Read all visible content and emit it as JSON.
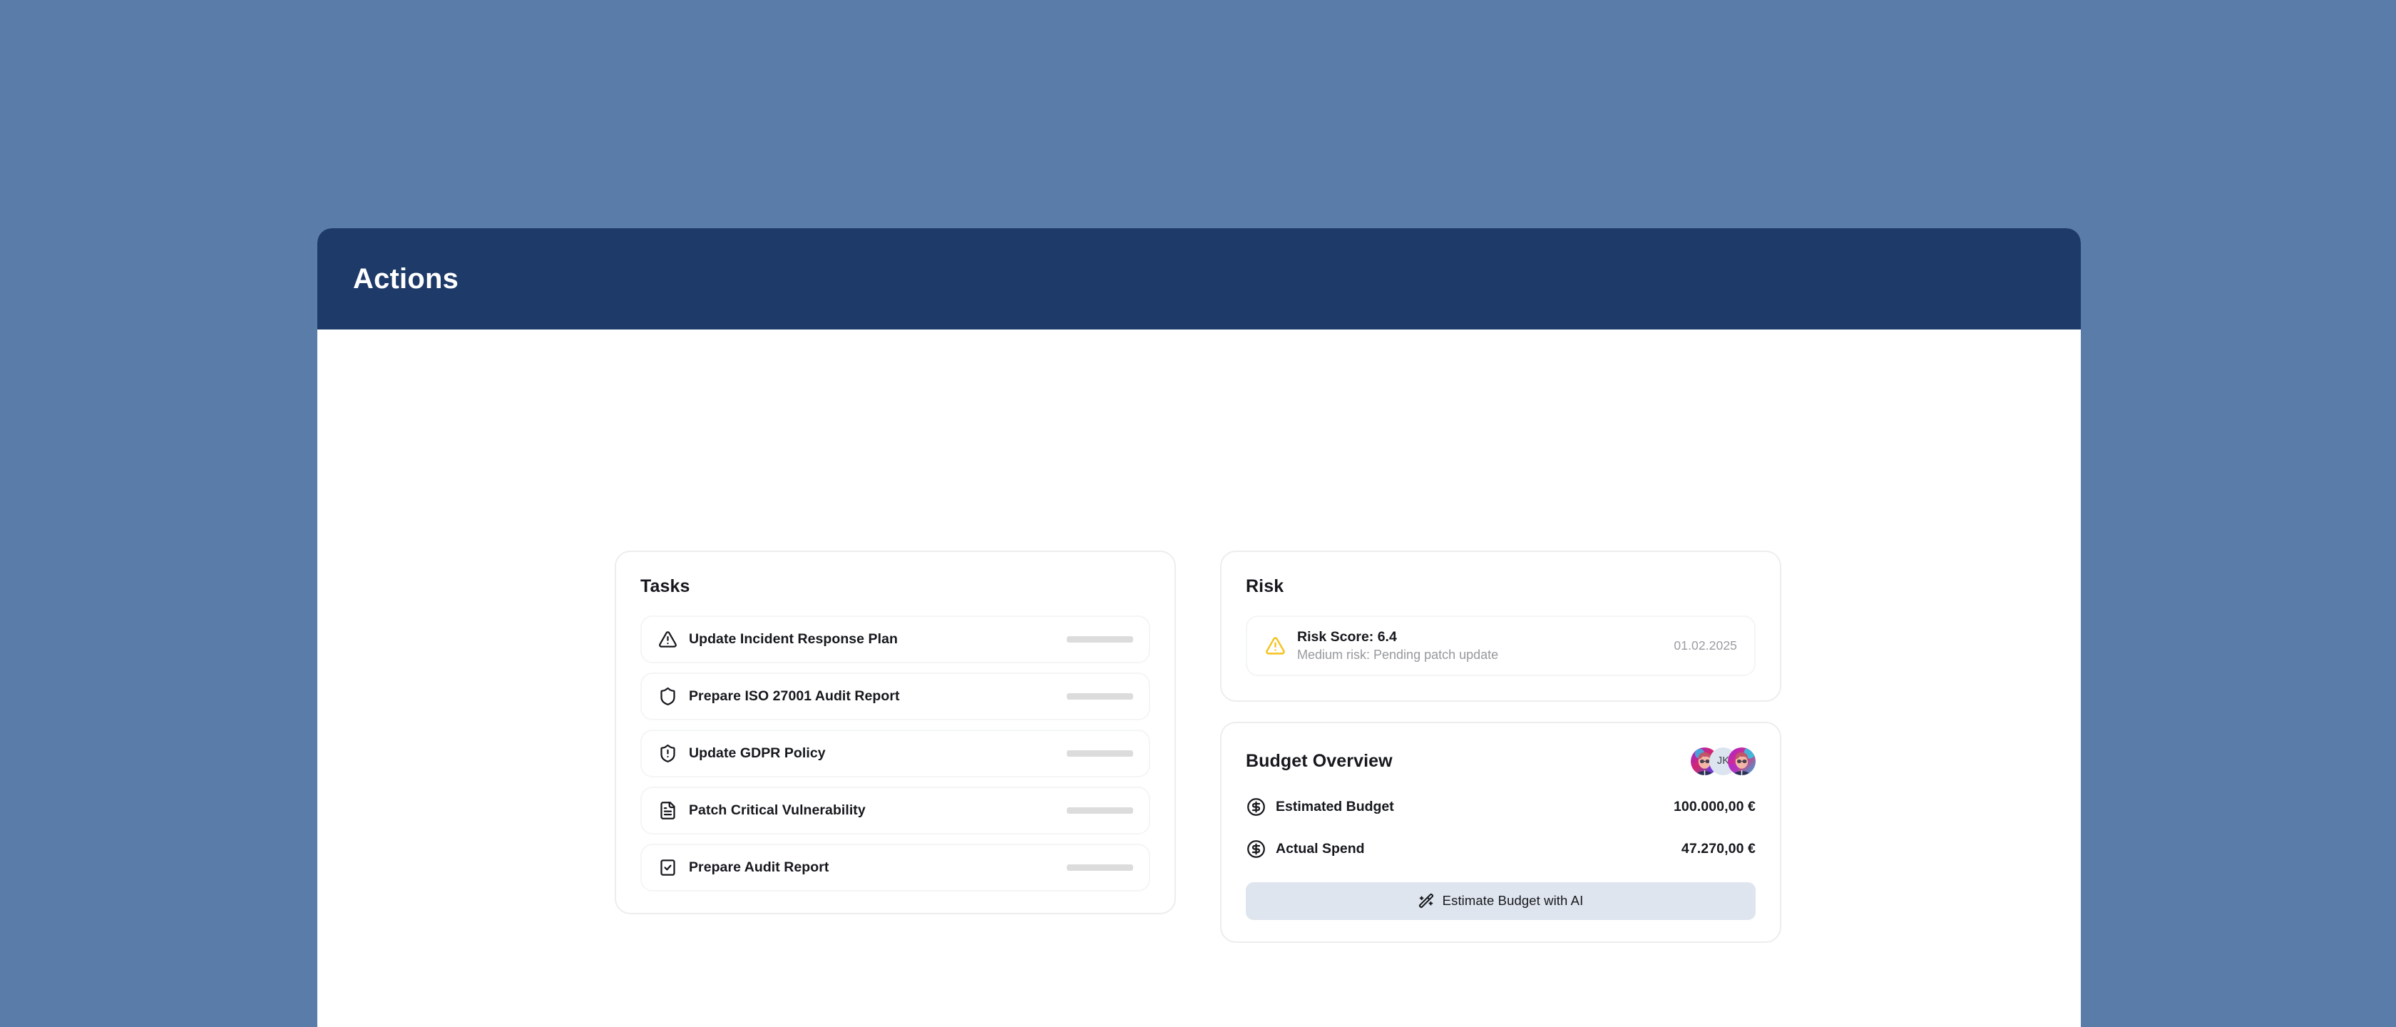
{
  "theme": {
    "page_background": "#5a7ca8",
    "header_background": "#1e3a68",
    "panel_background": "#ffffff",
    "card_border": "#eceded",
    "row_border": "#f4f5f6",
    "skeleton": "#dcdcdd",
    "warning_amber": "#f5c21b",
    "ai_button_background": "#dfe5ee",
    "text_primary": "#16181d",
    "text_muted": "#97999d"
  },
  "header": {
    "title": "Actions"
  },
  "tasks_card": {
    "title": "Tasks",
    "items": [
      {
        "label": "Update Incident Response Plan",
        "icon": "alert-triangle-icon"
      },
      {
        "label": "Prepare ISO 27001 Audit Report",
        "icon": "shield-icon"
      },
      {
        "label": "Update GDPR Policy",
        "icon": "shield-alert-icon"
      },
      {
        "label": "Patch Critical Vulnerability",
        "icon": "file-text-icon"
      },
      {
        "label": "Prepare Audit Report",
        "icon": "clipboard-check-icon"
      }
    ]
  },
  "risk_card": {
    "title": "Risk",
    "entry": {
      "icon": "alert-triangle-icon",
      "score": "Risk Score: 6.4",
      "description": "Medium risk: Pending patch update",
      "date": "01.02.2025"
    }
  },
  "budget_card": {
    "title": "Budget Overview",
    "avatars": [
      {
        "type": "image",
        "name": "avatar-user-1"
      },
      {
        "type": "initials",
        "initials": "JK",
        "name": "avatar-user-jk"
      },
      {
        "type": "image",
        "name": "avatar-user-3"
      }
    ],
    "rows": [
      {
        "label": "Estimated Budget",
        "value": "100.000,00 €",
        "icon": "circle-dollar-icon"
      },
      {
        "label": "Actual Spend",
        "value": "47.270,00 €",
        "icon": "circle-dollar-icon"
      }
    ],
    "ai_button": {
      "label": "Estimate Budget with AI",
      "icon": "wand-sparkles-icon"
    }
  }
}
